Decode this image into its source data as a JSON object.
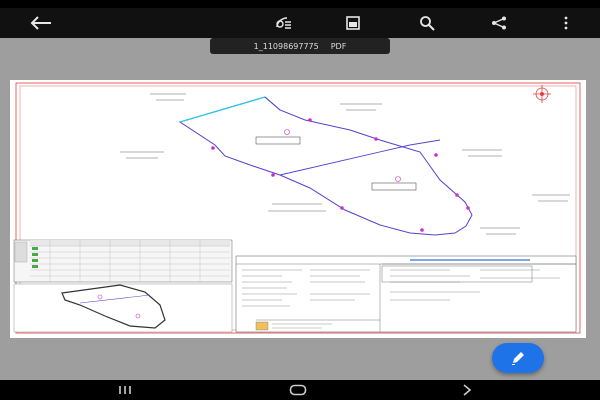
{
  "document": {
    "file_name": "1_11098697775",
    "file_type": "PDF"
  },
  "colors": {
    "toolbar_bg": "#111111",
    "fab_bg": "#1e73e8",
    "map_outline": "#5a3fd0",
    "map_markers": "#c832c8",
    "edge_highlight": "#2fc8e8",
    "border_red": "#e04040"
  },
  "icons": {
    "back": "arrow-left-icon",
    "reader_mode": "reader-mode-icon",
    "page_view": "page-view-icon",
    "search": "search-icon",
    "share": "share-icon",
    "more": "more-vert-icon",
    "edit": "pencil-icon",
    "nav_recents": "recents-icon",
    "nav_home": "home-icon",
    "nav_back": "chevron-back-icon"
  }
}
